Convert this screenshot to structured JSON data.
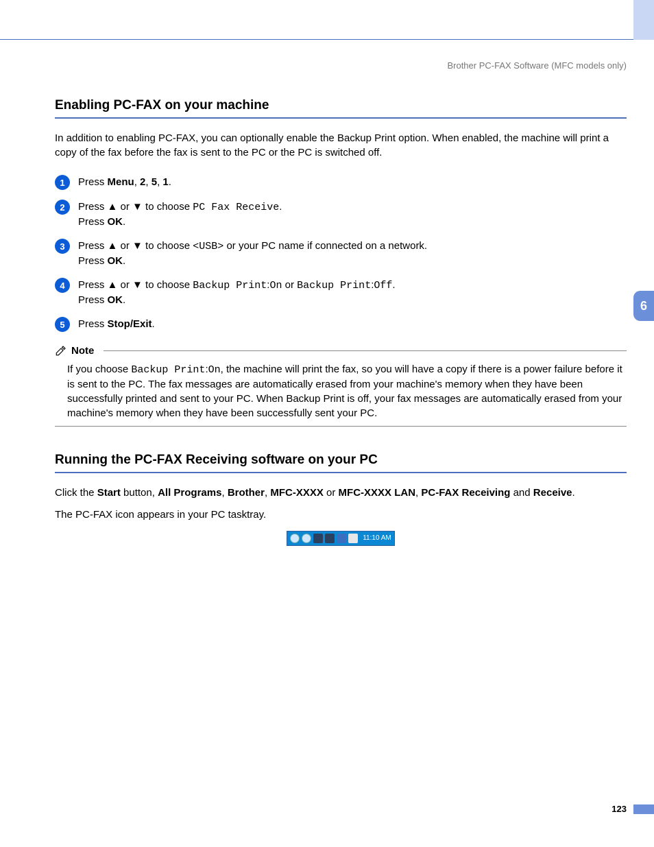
{
  "header": {
    "crumb": "Brother PC-FAX Software (MFC models only)"
  },
  "chapter_tab": "6",
  "page_number": "123",
  "section1": {
    "title": "Enabling PC-FAX on your machine",
    "intro": "In addition to enabling PC-FAX, you can optionally enable the Backup Print option. When enabled, the machine will print a copy of the fax before the fax is sent to the PC or the PC is switched off.",
    "steps": [
      {
        "n": "1",
        "html": "Press <b>Menu</b>, <b>2</b>, <b>5</b>, <b>1</b>."
      },
      {
        "n": "2",
        "html": "Press ▲ or ▼ to choose <span class='mono'>PC Fax Receive</span>.<br>Press <b>OK</b>."
      },
      {
        "n": "3",
        "html": "Press ▲ or ▼ to choose <span class='mono'>&lt;USB&gt;</span> or your PC name if connected on a network.<br>Press <b>OK</b>."
      },
      {
        "n": "4",
        "html": "Press ▲ or ▼ to choose <span class='mono'>Backup Print</span>:<span class='mono'>On</span> or <span class='mono'>Backup Print</span>:<span class='mono'>Off</span>.<br>Press <b>OK</b>."
      },
      {
        "n": "5",
        "html": "Press <b>Stop/Exit</b>."
      }
    ],
    "note_label": "Note",
    "note_html": "If you choose <span class='mono'>Backup Print</span>:<span class='mono'>On</span>, the machine will print the fax, so you will have a copy if there is a power failure before it is sent to the PC. The fax messages are automatically erased from your machine's memory when they have been successfully printed and sent to your PC. When Backup Print is off, your fax messages are automatically erased from your machine's memory when they have been successfully sent your PC."
  },
  "section2": {
    "title": "Running the PC-FAX Receiving software on your PC",
    "para1_html": "Click the <b>Start</b> button, <b>All Programs</b>, <b>Brother</b>, <b>MFC-XXXX</b> or <b>MFC-XXXX LAN</b>, <b>PC-FAX Receiving</b> and <b>Receive</b>.",
    "para2": "The PC-FAX icon appears in your PC tasktray.",
    "tray_time": "11:10 AM"
  }
}
